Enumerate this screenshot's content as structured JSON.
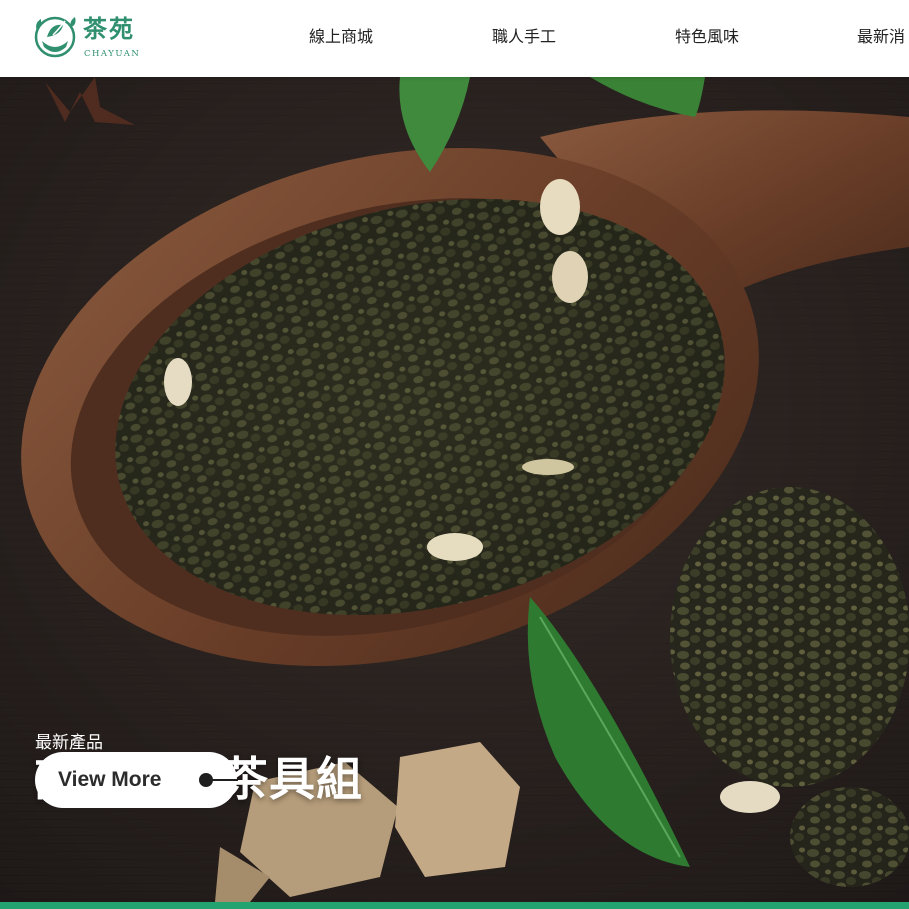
{
  "brand": {
    "name_cn": "茶苑",
    "name_en": "CHAYUAN",
    "icon": "tea-cup-leaf-logo-icon",
    "color": "#2f8f6f"
  },
  "nav": {
    "items": [
      {
        "label": "線上商城"
      },
      {
        "label": "職人手工"
      },
      {
        "label": "特色風味"
      },
      {
        "label": "最新消"
      }
    ]
  },
  "hero": {
    "subtitle": "最新產品",
    "title": "高級檜木茶具組",
    "cta_label": "View More",
    "cta_icon": "arrow-right-icon"
  },
  "colors": {
    "accent": "#22a36f",
    "header_bg": "#ffffff"
  }
}
